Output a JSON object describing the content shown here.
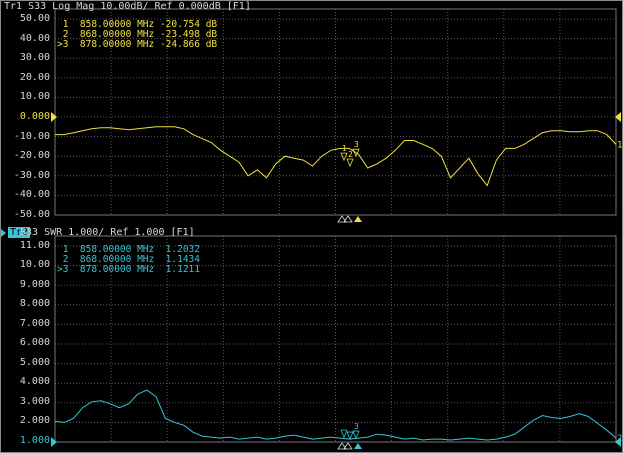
{
  "trace1": {
    "title": "Tr1 S33 Log Mag 10.00dB/ Ref 0.000dB [F1]",
    "y_labels": [
      "50.00",
      "40.00",
      "30.00",
      "20.00",
      "10.00",
      "0.000",
      "-10.00",
      "-20.00",
      "-30.00",
      "-40.00",
      "-50.00"
    ],
    "markers": [
      {
        "label": " 1  858.00000 MHz -20.754 dB"
      },
      {
        "label": " 2  868.00000 MHz -23.498 dB"
      },
      {
        "label": ">3  878.00000 MHz -24.866 dB"
      }
    ],
    "color": "#f0e040",
    "end_marker_label": "1",
    "marker_nums": [
      "1",
      "2",
      "3"
    ]
  },
  "trace2": {
    "badge": "Tr2",
    "title": "S33 SWR 1.000/ Ref 1.000 [F1]",
    "y_labels": [
      "11.00",
      "10.00",
      "9.000",
      "8.000",
      "7.000",
      "6.000",
      "5.000",
      "4.000",
      "3.000",
      "2.000",
      "1.000"
    ],
    "markers": [
      {
        "label": " 1  858.00000 MHz  1.2032"
      },
      {
        "label": " 2  868.00000 MHz  1.1434"
      },
      {
        "label": ">3  878.00000 MHz  1.1211"
      }
    ],
    "color": "#36c6d8",
    "end_marker_label": "2",
    "marker_nums": [
      "3"
    ]
  },
  "chart_data": [
    {
      "type": "line",
      "ylim": [
        -50,
        50
      ],
      "ref_value": 0,
      "series": [
        {
          "values": [
            -9,
            -9,
            -8,
            -7,
            -6,
            -5.5,
            -5.5,
            -6,
            -6.5,
            -6,
            -5.5,
            -5,
            -5,
            -5,
            -6,
            -9,
            -11,
            -13,
            -17,
            -20,
            -23,
            -30,
            -27,
            -31,
            -24,
            -20,
            -21,
            -22,
            -25,
            -20,
            -17,
            -16,
            -16,
            -19,
            -26,
            -24,
            -21,
            -17,
            -12,
            -12,
            -14,
            -16,
            -20,
            -31,
            -26,
            -21,
            -29,
            -35,
            -22,
            -16,
            -16,
            -14,
            -11,
            -8,
            -7,
            -7,
            -7.5,
            -7.5,
            -7,
            -7,
            -9,
            -14
          ]
        }
      ]
    },
    {
      "type": "line",
      "ylim": [
        1,
        11
      ],
      "ref_value": 1,
      "series": [
        {
          "values": [
            2.05,
            2.0,
            2.2,
            2.75,
            3.05,
            3.1,
            2.95,
            2.75,
            2.95,
            3.45,
            3.65,
            3.3,
            2.2,
            2.0,
            1.85,
            1.5,
            1.3,
            1.25,
            1.2,
            1.25,
            1.15,
            1.2,
            1.25,
            1.15,
            1.2,
            1.3,
            1.35,
            1.25,
            1.15,
            1.2,
            1.25,
            1.2,
            1.15,
            1.2,
            1.25,
            1.4,
            1.35,
            1.25,
            1.15,
            1.2,
            1.1,
            1.15,
            1.15,
            1.1,
            1.15,
            1.2,
            1.15,
            1.1,
            1.15,
            1.25,
            1.4,
            1.75,
            2.1,
            2.35,
            2.25,
            2.2,
            2.3,
            2.45,
            2.3,
            1.95,
            1.6,
            1.2
          ]
        }
      ]
    }
  ]
}
